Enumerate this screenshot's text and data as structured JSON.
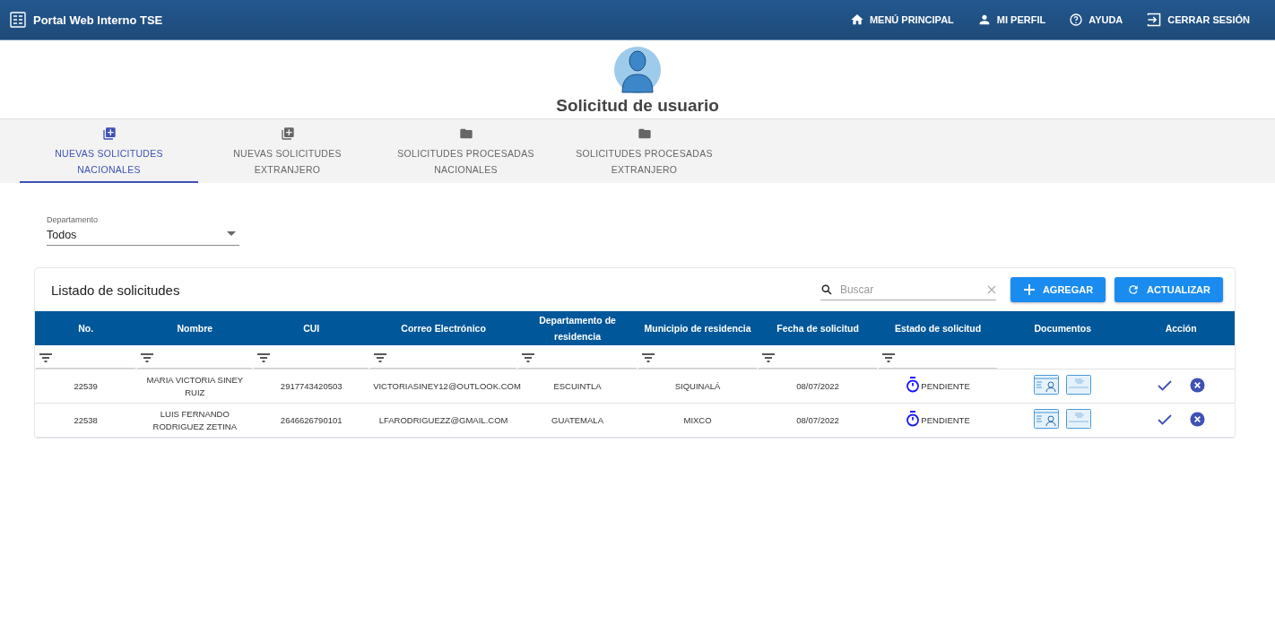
{
  "app_bar": {
    "title": "Portal Web Interno TSE",
    "nav": [
      {
        "kind": "home",
        "label": "MENÚ PRINCIPAL"
      },
      {
        "kind": "profile",
        "label": "MI PERFIL"
      },
      {
        "kind": "help",
        "label": "AYUDA"
      },
      {
        "kind": "logout",
        "label": "CERRAR SESIÓN"
      }
    ]
  },
  "page_title": "Solicitud de usuario",
  "tabs": [
    {
      "kind": "add",
      "line1": "NUEVAS SOLICITUDES",
      "line2": "NACIONALES",
      "selected": true
    },
    {
      "kind": "add",
      "line1": "NUEVAS SOLICITUDES",
      "line2": "EXTRANJERO",
      "selected": false
    },
    {
      "kind": "folder",
      "line1": "SOLICITUDES PROCESADAS",
      "line2": "NACIONALES",
      "selected": false
    },
    {
      "kind": "folder",
      "line1": "SOLICITUDES PROCESADAS",
      "line2": "EXTRANJERO",
      "selected": false
    }
  ],
  "department_select": {
    "label": "Departamento",
    "value": "Todos"
  },
  "list": {
    "title": "Listado de solicitudes",
    "search": {
      "placeholder": "Buscar"
    },
    "buttons": [
      {
        "kind": "add",
        "label": "AGREGAR"
      },
      {
        "kind": "refresh",
        "label": "ACTUALIZAR"
      }
    ],
    "columns": [
      {
        "label": "No.",
        "filter": true
      },
      {
        "label": "Nombre",
        "filter": true
      },
      {
        "label": "CUI",
        "filter": true
      },
      {
        "label": "Correo Electrónico",
        "filter": true
      },
      {
        "label": "Departamento de residencia",
        "filter": true
      },
      {
        "label": "Municipio de residencia",
        "filter": true
      },
      {
        "label": "Fecha de solicitud",
        "filter": true
      },
      {
        "label": "Estado de solicitud",
        "filter": true
      },
      {
        "label": "Documentos",
        "filter": false
      },
      {
        "label": "Acción",
        "filter": false
      }
    ],
    "rows": [
      {
        "no": "22539",
        "name": "MARIA VICTORIA SINEY RUIZ",
        "cui": "2917743420503",
        "email": "VICTORIASINEY12@OUTLOOK.COM",
        "department": "ESCUINTLA",
        "municipality": "SIQUINALÁ",
        "date": "08/07/2022",
        "status": "PENDIENTE"
      },
      {
        "no": "22538",
        "name": "LUIS FERNANDO RODRIGUEZ ZETINA",
        "cui": "2646626790101",
        "email": "LFARODRIGUEZZ@GMAIL.COM",
        "department": "GUATEMALA",
        "municipality": "MIXCO",
        "date": "08/07/2022",
        "status": "PENDIENTE"
      }
    ]
  }
}
